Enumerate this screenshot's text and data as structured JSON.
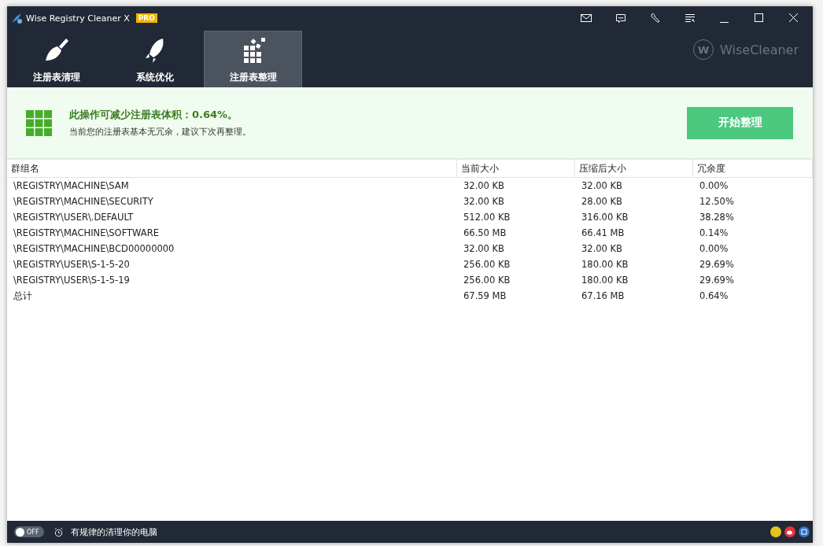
{
  "window": {
    "title": "Wise Registry Cleaner X",
    "badge": "PRO"
  },
  "tabs": [
    {
      "label": "注册表清理",
      "kind": "broom",
      "selected": false
    },
    {
      "label": "系统优化",
      "kind": "rocket",
      "selected": false
    },
    {
      "label": "注册表整理",
      "kind": "blocks",
      "selected": true
    }
  ],
  "brand_mark": "W",
  "brand": "WiseCleaner",
  "banner": {
    "headline": "此操作可减少注册表体积：0.64%。",
    "message": "当前您的注册表基本无冗余，建议下次再整理。",
    "button": "开始整理"
  },
  "table": {
    "columns": [
      "群组名",
      "当前大小",
      "压缩后大小",
      "冗余度"
    ],
    "rows": [
      [
        "\\REGISTRY\\MACHINE\\SAM",
        "32.00 KB",
        "32.00 KB",
        "0.00%"
      ],
      [
        "\\REGISTRY\\MACHINE\\SECURITY",
        "32.00 KB",
        "28.00 KB",
        "12.50%"
      ],
      [
        "\\REGISTRY\\USER\\.DEFAULT",
        "512.00 KB",
        "316.00 KB",
        "38.28%"
      ],
      [
        "\\REGISTRY\\MACHINE\\SOFTWARE",
        "66.50 MB",
        "66.41 MB",
        "0.14%"
      ],
      [
        "\\REGISTRY\\MACHINE\\BCD00000000",
        "32.00 KB",
        "32.00 KB",
        "0.00%"
      ],
      [
        "\\REGISTRY\\USER\\S-1-5-20",
        "256.00 KB",
        "180.00 KB",
        "29.69%"
      ],
      [
        "\\REGISTRY\\USER\\S-1-5-19",
        "256.00 KB",
        "180.00 KB",
        "29.69%"
      ],
      [
        "总计",
        "67.59 MB",
        "67.16 MB",
        "0.64%"
      ]
    ]
  },
  "status_bar": {
    "schedule_toggle": {
      "on": false,
      "label": "OFF"
    },
    "schedule_text": "有规律的清理你的电脑"
  }
}
